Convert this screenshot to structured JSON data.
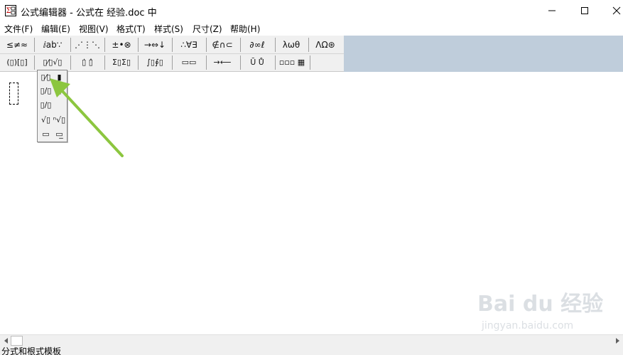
{
  "window": {
    "title": "公式编辑器 - 公式在 经验.doc 中",
    "icon": "equation-editor-app-icon",
    "controls": [
      "minimize-icon",
      "maximize-icon",
      "close-icon"
    ]
  },
  "menu": {
    "items": [
      "文件(F)",
      "编辑(E)",
      "视图(V)",
      "格式(T)",
      "样式(S)",
      "尺寸(Z)",
      "帮助(H)"
    ]
  },
  "toolbar": {
    "row1": [
      "≤≠≈",
      "ⅈab∵",
      "⋰⋮⋱",
      "±•⊗",
      "→⇔↓",
      "∴∀∃",
      "∉∩⊂",
      "∂∞ℓ",
      "λωθ",
      "ΛΩ⊛"
    ],
    "row2": [
      "(▯)[▯]",
      "▯⁄▯√▯",
      "▯̇ ▯̂",
      "Σ▯Σ▯",
      "∫▯∮▯",
      "▭▭",
      "→⟵",
      "Ū Ů",
      "▫▫▫ ▦"
    ]
  },
  "palette": {
    "cells": [
      "▯⁄▯",
      "▮",
      "▯/▯",
      "▯",
      "▯/▯",
      "",
      "√▯",
      "ⁿ√▯",
      "▭",
      "▭̲"
    ]
  },
  "watermark": {
    "logo": "Bai du 经验",
    "url": "jingyan.baidu.com"
  },
  "status": {
    "text": "分式和根式模板"
  },
  "colors": {
    "toolbar_bg": "#bfcddb",
    "arrow": "#8cc63f"
  }
}
